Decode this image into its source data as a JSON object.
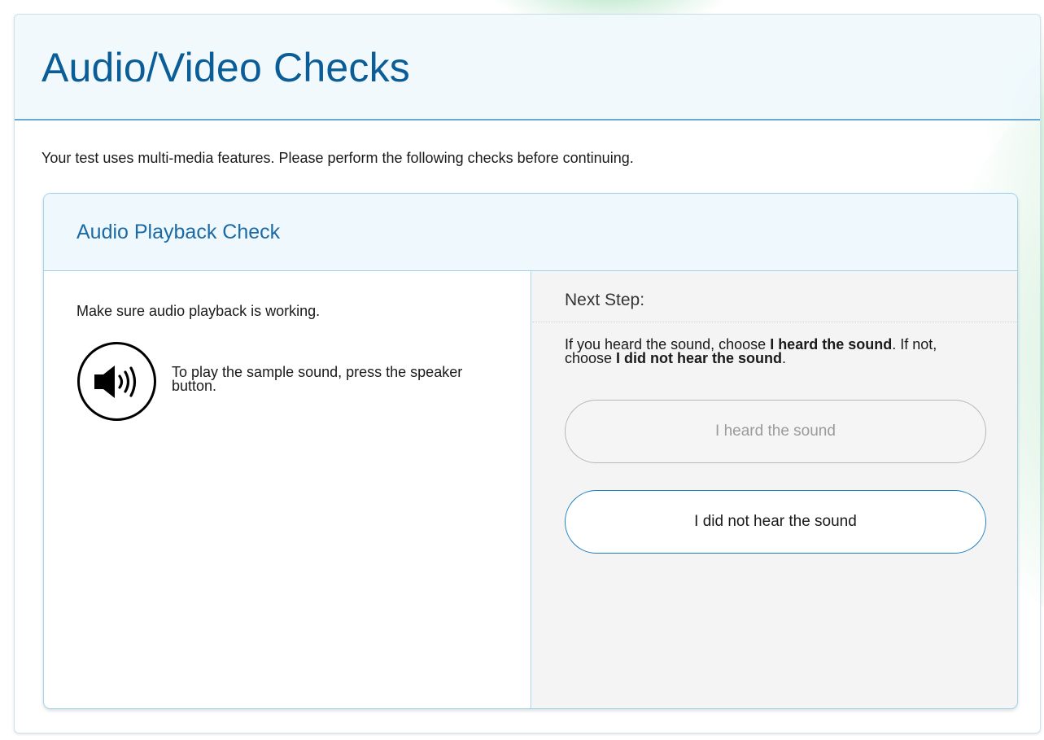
{
  "page": {
    "title": "Audio/Video Checks",
    "intro": "Your test uses multi-media features. Please perform the following checks before continuing."
  },
  "audio_check": {
    "title": "Audio Playback Check",
    "left": {
      "message": "Make sure audio playback is working.",
      "speaker_icon": "speaker-volume-icon",
      "hint": "To play the sample sound, press the speaker button."
    },
    "right": {
      "heading": "Next Step:",
      "instructions": {
        "p1": "If you heard the sound, choose ",
        "b1": "I heard the sound",
        "p2": ". If not, choose ",
        "b2": "I did not hear the sound",
        "p3": "."
      },
      "buttons": {
        "heard": "I heard the sound",
        "not_heard": "I did not hear the sound"
      }
    }
  },
  "colors": {
    "title_blue": "#0a5d96",
    "panel_title_blue": "#1c6aa4",
    "border_blue": "#9fd3ee",
    "button_border_blue": "#1e7fbf",
    "disabled_text": "#9a9a9a"
  }
}
